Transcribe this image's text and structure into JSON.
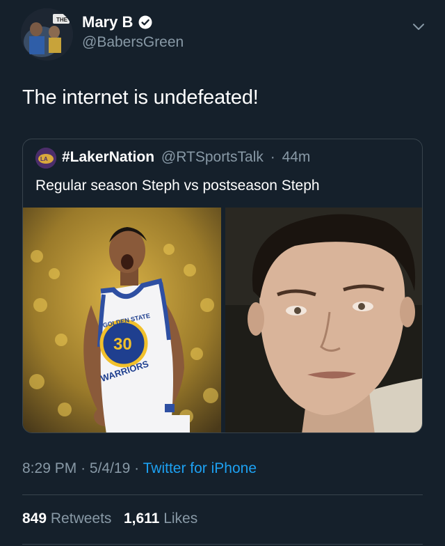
{
  "author": {
    "display_name": "Mary B",
    "handle": "@BabersGreen",
    "verified": true,
    "avatar_icon": "avatar-photo"
  },
  "tweet": {
    "text": "The internet is undefeated!"
  },
  "quoted_tweet": {
    "display_name": "#LakerNation",
    "handle": "@RTSportsTalk",
    "separator": "·",
    "time_ago": "44m",
    "text": "Regular season Steph vs postseason Steph",
    "photos": [
      "photo-basketball-player-jersey",
      "photo-man-closeup-face"
    ],
    "jersey_text": "GOLDEN STATE",
    "jersey_number": "30",
    "jersey_team": "WARRIORS"
  },
  "meta": {
    "time": "8:29 PM",
    "sep1": "·",
    "date": "5/4/19",
    "sep2": "·",
    "source": "Twitter for iPhone"
  },
  "stats": {
    "retweets_count": "849",
    "retweets_label": "Retweets",
    "likes_count": "1,611",
    "likes_label": "Likes"
  },
  "colors": {
    "background": "#15202b",
    "secondary_text": "#8899a6",
    "link": "#1da1f2",
    "border": "#38444d"
  }
}
